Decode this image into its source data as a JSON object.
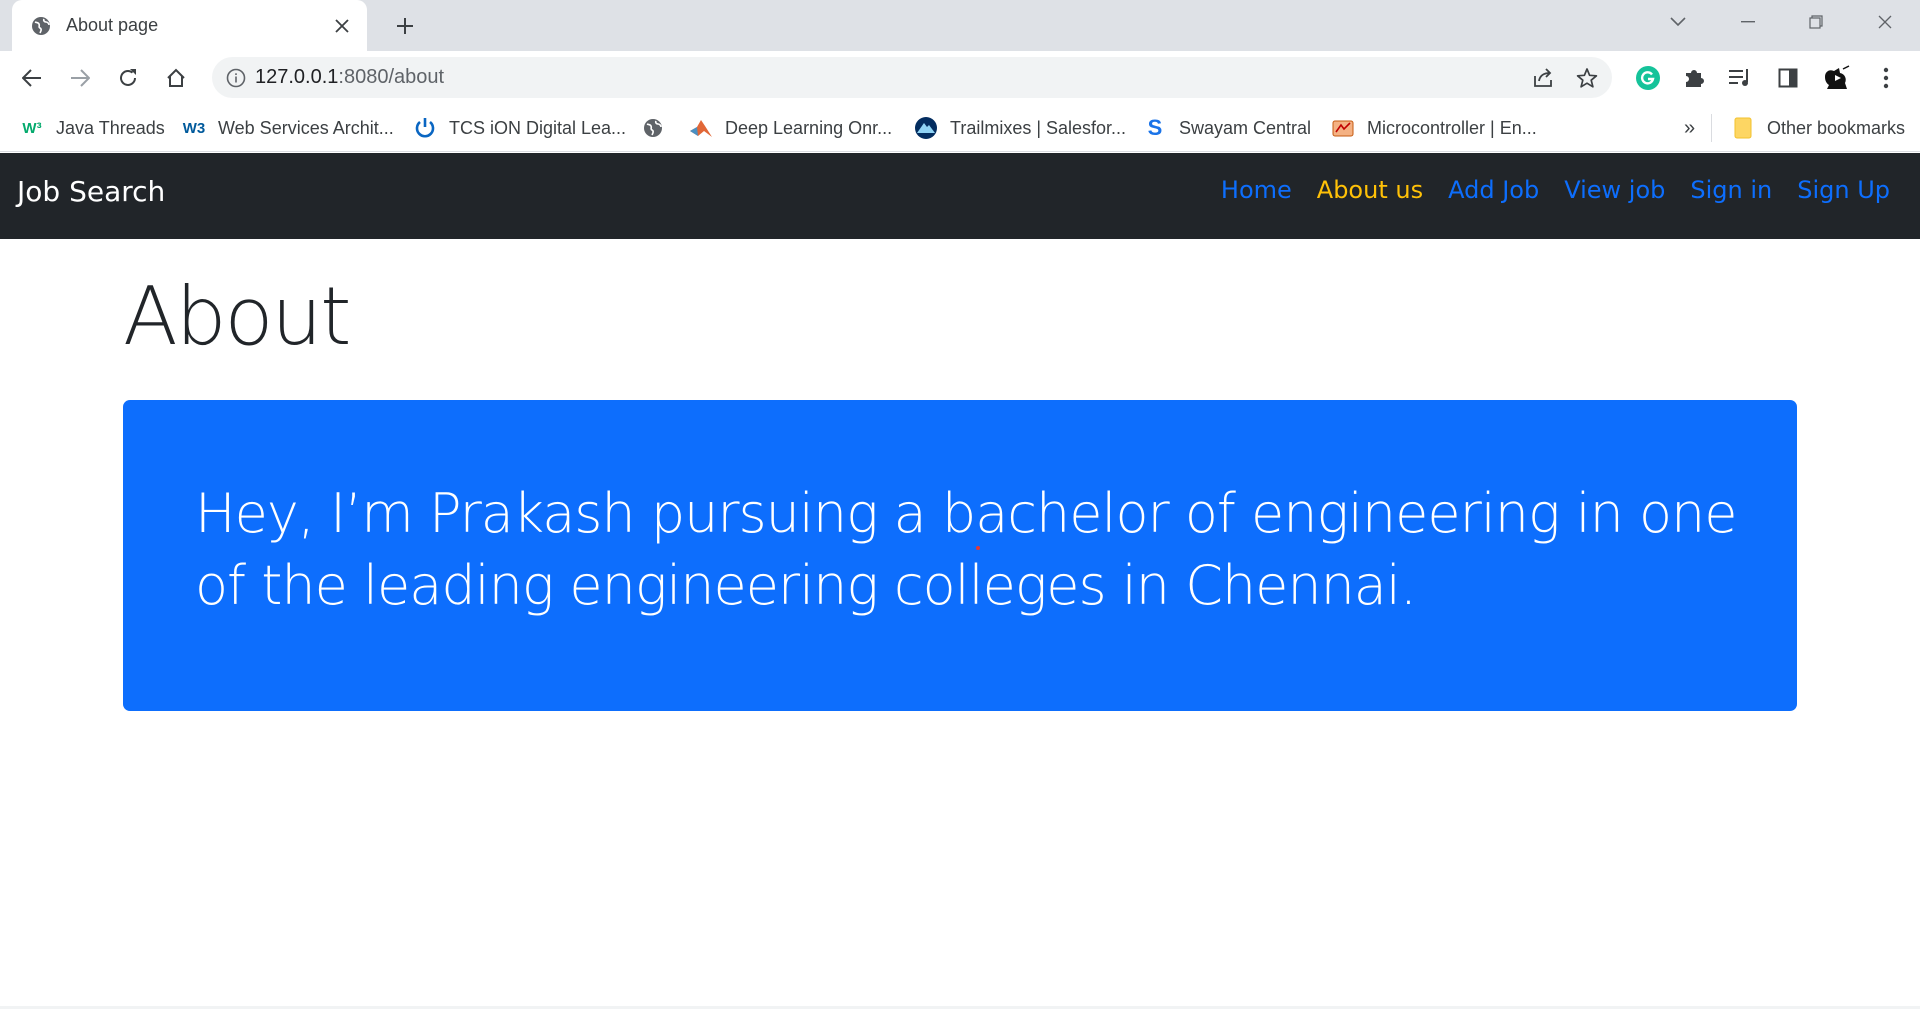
{
  "browser": {
    "tab": {
      "title": "About page",
      "favicon": "globe-icon"
    },
    "url": {
      "host": "127.0.0.1",
      "path": ":8080/about"
    },
    "bookmarks": [
      {
        "label": "Java Threads",
        "icon": "w3-green-icon"
      },
      {
        "label": "Web Services Archit...",
        "icon": "w3c-icon"
      },
      {
        "label": "TCS iON Digital Lea...",
        "icon": "power-icon"
      },
      {
        "label": "",
        "icon": "globe-icon"
      },
      {
        "label": "Deep Learning Onr...",
        "icon": "matlab-icon"
      },
      {
        "label": "Trailmixes | Salesfor...",
        "icon": "trailhead-icon"
      },
      {
        "label": "Swayam Central",
        "icon": "swayam-icon"
      },
      {
        "label": "Microcontroller | En...",
        "icon": "microcontroller-icon"
      }
    ],
    "overflow_label": "»",
    "other_bookmarks": "Other bookmarks"
  },
  "site": {
    "brand": "Job Search",
    "nav": [
      {
        "label": "Home",
        "active": false
      },
      {
        "label": "About us",
        "active": true
      },
      {
        "label": "Add Job",
        "active": false
      },
      {
        "label": "View job",
        "active": false
      },
      {
        "label": "Sign in",
        "active": false
      },
      {
        "label": "Sign Up",
        "active": false
      }
    ],
    "heading": "About",
    "lead": "Hey, I’m Prakash pursuing a bachelor of engineering in one of the leading engineering colleges in Chennai."
  },
  "colors": {
    "navbar_bg": "#212529",
    "nav_link": "#0d6efd",
    "nav_active": "#ffc107",
    "jumbotron_bg": "#0d6efd"
  }
}
